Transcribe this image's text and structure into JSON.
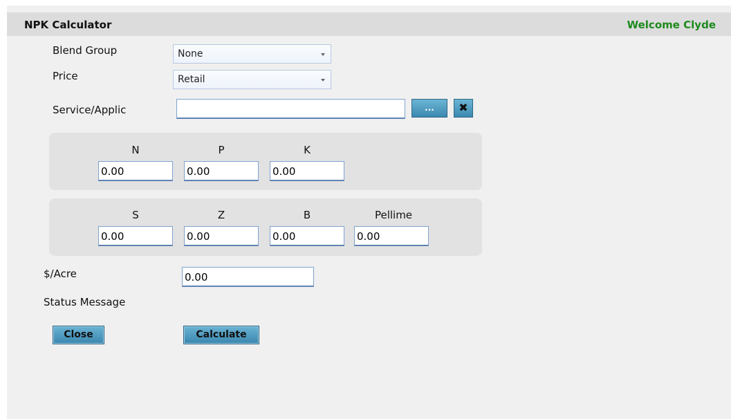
{
  "header": {
    "title": "NPK Calculator",
    "welcome": "Welcome Clyde"
  },
  "form": {
    "blend_group": {
      "label": "Blend Group",
      "value": "None"
    },
    "price": {
      "label": "Price",
      "value": "Retail"
    },
    "service": {
      "label": "Service/Applic",
      "value": "",
      "browse_label": "...",
      "clear_label": "✖"
    }
  },
  "npk": {
    "n": {
      "label": "N",
      "value": "0.00"
    },
    "p": {
      "label": "P",
      "value": "0.00"
    },
    "k": {
      "label": "K",
      "value": "0.00"
    }
  },
  "micros": {
    "s": {
      "label": "S",
      "value": "0.00"
    },
    "z": {
      "label": "Z",
      "value": "0.00"
    },
    "b": {
      "label": "B",
      "value": "0.00"
    },
    "pellime": {
      "label": "Pellime",
      "value": "0.00"
    }
  },
  "acre": {
    "label": "$/Acre",
    "value": "0.00"
  },
  "status": {
    "label": "Status Message"
  },
  "buttons": {
    "close": "Close",
    "calculate": "Calculate"
  },
  "colors": {
    "accent_button": "#4a9cc2",
    "welcome_text": "#1e8a1e"
  }
}
